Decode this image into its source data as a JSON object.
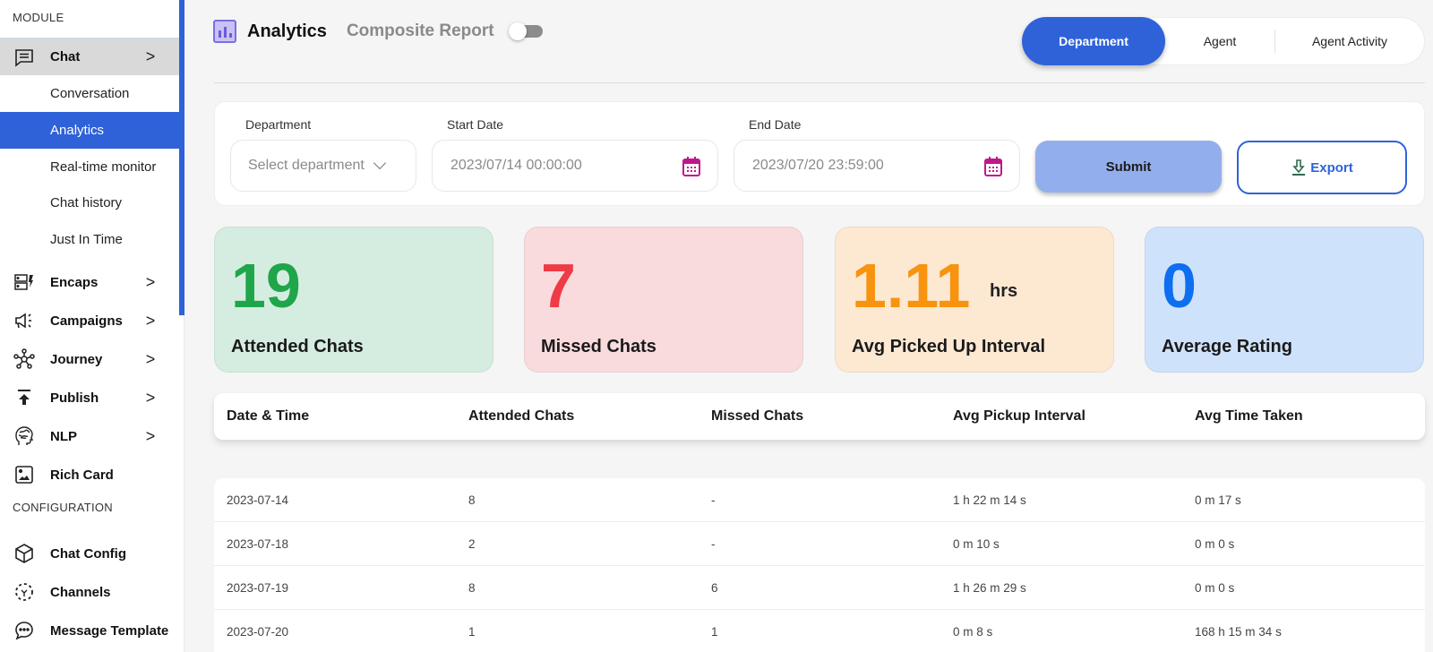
{
  "sidebar": {
    "section_module": "MODULE",
    "section_configuration": "CONFIGURATION",
    "chat": {
      "label": "Chat",
      "icon": "chat-icon"
    },
    "chat_subitems": [
      {
        "label": "Conversation",
        "active": false
      },
      {
        "label": "Analytics",
        "active": true
      },
      {
        "label": "Real-time monitor",
        "active": false
      },
      {
        "label": "Chat history",
        "active": false
      },
      {
        "label": "Just In Time",
        "active": false
      }
    ],
    "module_items": [
      {
        "label": "Encaps",
        "icon": "encaps-icon",
        "has_chevron": true
      },
      {
        "label": "Campaigns",
        "icon": "megaphone-icon",
        "has_chevron": true
      },
      {
        "label": "Journey",
        "icon": "network-icon",
        "has_chevron": true
      },
      {
        "label": "Publish",
        "icon": "publish-icon",
        "has_chevron": true
      },
      {
        "label": "NLP",
        "icon": "brain-head-icon",
        "has_chevron": true
      },
      {
        "label": "Rich Card",
        "icon": "image-icon",
        "has_chevron": false
      }
    ],
    "config_items": [
      {
        "label": "Chat Config",
        "icon": "cube-icon"
      },
      {
        "label": "Channels",
        "icon": "channels-icon"
      },
      {
        "label": "Message Template",
        "icon": "message-icon"
      }
    ],
    "chevron_glyph": ">"
  },
  "header": {
    "title": "Analytics",
    "composite_label": "Composite Report",
    "composite_enabled": false,
    "tabs": [
      {
        "label": "Department",
        "active": true
      },
      {
        "label": "Agent",
        "active": false
      },
      {
        "label": "Agent Activity",
        "active": false
      }
    ]
  },
  "filters": {
    "department_label": "Department",
    "department_placeholder": "Select department",
    "start_label": "Start Date",
    "start_value": "2023/07/14 00:00:00",
    "end_label": "End Date",
    "end_value": "2023/07/20 23:59:00",
    "submit_label": "Submit",
    "export_label": "Export"
  },
  "cards": [
    {
      "value": "19",
      "unit": "",
      "caption": "Attended Chats",
      "bg": "#d5ede0",
      "color": "#1fa64a"
    },
    {
      "value": "7",
      "unit": "",
      "caption": "Missed Chats",
      "bg": "#f9dbdd",
      "color": "#ee3b45"
    },
    {
      "value": "1.11",
      "unit": "hrs",
      "caption": "Avg Picked Up Interval",
      "bg": "#fde8d2",
      "color": "#f7930e"
    },
    {
      "value": "0",
      "unit": "",
      "caption": "Average Rating",
      "bg": "#cfe2fc",
      "color": "#0d6ef0"
    }
  ],
  "table": {
    "columns": [
      "Date & Time",
      "Attended Chats",
      "Missed Chats",
      "Avg Pickup Interval",
      "Avg Time Taken"
    ],
    "rows": [
      [
        "2023-07-14",
        "8",
        "-",
        "1 h 22 m 14 s",
        "0 m 17 s"
      ],
      [
        "2023-07-18",
        "2",
        "-",
        "0 m 10 s",
        "0 m 0 s"
      ],
      [
        "2023-07-19",
        "8",
        "6",
        "1 h 26 m 29 s",
        "0 m 0 s"
      ],
      [
        "2023-07-20",
        "1",
        "1",
        "0 m 8 s",
        "168 h 15 m 34 s"
      ]
    ]
  },
  "colors": {
    "accent": "#2f62d9",
    "submit_bg": "#93aeec",
    "calendar_icon": "#c0168c"
  }
}
